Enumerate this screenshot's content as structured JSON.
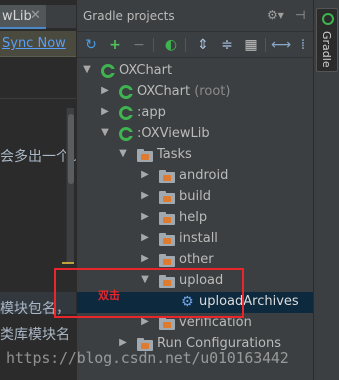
{
  "editor": {
    "tab_label": "wLib",
    "tab_close": "✕",
    "sync_link": "Sync Now",
    "lines": [
      "会多出一个u",
      "模块包名，",
      "类库模块名"
    ]
  },
  "gradle_panel": {
    "title": "Gradle projects",
    "header_icons": [
      "gear-icon",
      "pin-icon"
    ],
    "toolbar_icons": [
      "refresh-icon",
      "add-icon",
      "remove-icon",
      "gradle-run-icon",
      "expand-all-icon",
      "collapse-all-icon",
      "group-icon",
      "toggle-offline-icon",
      "settings-icon"
    ],
    "tree": [
      {
        "label": "OXChart",
        "type": "project",
        "expanded": true
      },
      {
        "label": "OXChart",
        "suffix": "(root)",
        "type": "project",
        "expanded": false
      },
      {
        "label": ":app",
        "type": "project",
        "expanded": false
      },
      {
        "label": ":OXViewLib",
        "type": "project",
        "expanded": true
      },
      {
        "label": "Tasks",
        "type": "folder",
        "expanded": true
      },
      {
        "label": "android",
        "type": "folder",
        "expanded": false
      },
      {
        "label": "build",
        "type": "folder",
        "expanded": false
      },
      {
        "label": "help",
        "type": "folder",
        "expanded": false
      },
      {
        "label": "install",
        "type": "folder",
        "expanded": false
      },
      {
        "label": "other",
        "type": "folder",
        "expanded": false
      },
      {
        "label": "upload",
        "type": "folder",
        "expanded": true
      },
      {
        "label": "uploadArchives",
        "type": "task",
        "selected": true
      },
      {
        "label": "verification",
        "type": "folder",
        "expanded": false
      },
      {
        "label": "Run Configurations",
        "type": "folder",
        "expanded": false
      }
    ]
  },
  "annotation": {
    "text": "双击",
    "color": "#e8262b"
  },
  "side_strip": {
    "tab_label": "Gradle"
  },
  "watermark": "https://blog.csdn.net/u010163442",
  "colors": {
    "accent": "#3fb34f",
    "selection": "#0d293e",
    "link": "#589df6",
    "annotation": "#e8262b"
  }
}
